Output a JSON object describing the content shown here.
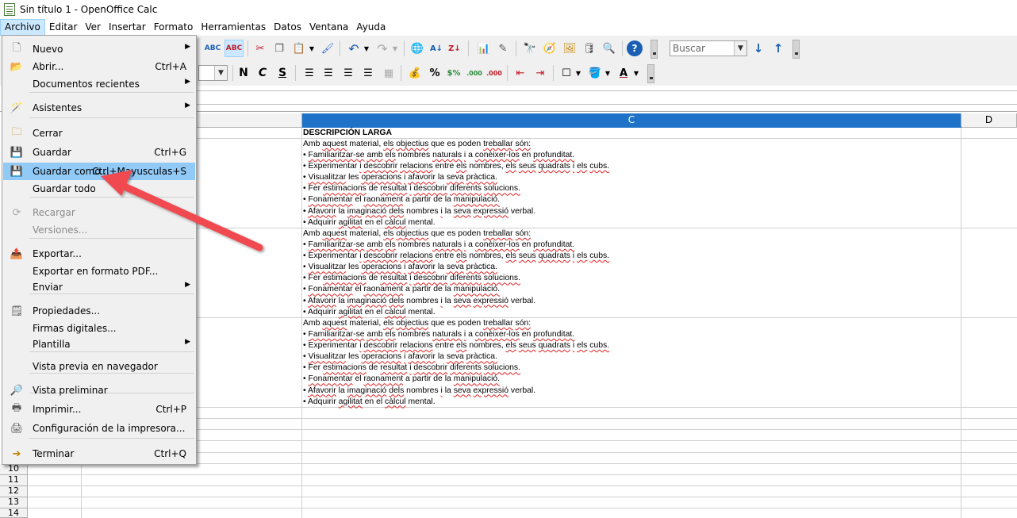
{
  "window": {
    "title": "Sin título 1 - OpenOffice Calc"
  },
  "menubar": [
    "Archivo",
    "Editar",
    "Ver",
    "Insertar",
    "Formato",
    "Herramientas",
    "Datos",
    "Ventana",
    "Ayuda"
  ],
  "toolbar": {
    "search_placeholder": "Buscar",
    "format_bold": "N",
    "format_italic": "C",
    "format_underline": "S"
  },
  "file_menu": {
    "items": [
      {
        "label": "Nuevo",
        "shortcut": "",
        "submenu": true,
        "icon": "new-document-icon"
      },
      {
        "label": "Abrir...",
        "shortcut": "Ctrl+A",
        "submenu": false,
        "icon": "open-folder-icon"
      },
      {
        "label": "Documentos recientes",
        "shortcut": "",
        "submenu": true,
        "icon": ""
      },
      {
        "label": "Asistentes",
        "shortcut": "",
        "submenu": true,
        "icon": "wizard-icon"
      },
      {
        "label": "Cerrar",
        "shortcut": "",
        "submenu": false,
        "icon": "close-document-icon"
      },
      {
        "label": "Guardar",
        "shortcut": "Ctrl+G",
        "submenu": false,
        "icon": "save-icon"
      },
      {
        "label": "Guardar como...",
        "shortcut": "Ctrl+Mayusculas+S",
        "submenu": false,
        "icon": "save-as-icon",
        "highlighted": true
      },
      {
        "label": "Guardar todo",
        "shortcut": "",
        "submenu": false,
        "icon": ""
      },
      {
        "label": "Recargar",
        "shortcut": "",
        "submenu": false,
        "icon": "reload-icon",
        "disabled": true
      },
      {
        "label": "Versiones...",
        "shortcut": "",
        "submenu": false,
        "icon": "",
        "disabled": true
      },
      {
        "label": "Exportar...",
        "shortcut": "",
        "submenu": false,
        "icon": "export-icon"
      },
      {
        "label": "Exportar en formato PDF...",
        "shortcut": "",
        "submenu": false,
        "icon": ""
      },
      {
        "label": "Enviar",
        "shortcut": "",
        "submenu": true,
        "icon": ""
      },
      {
        "label": "Propiedades...",
        "shortcut": "",
        "submenu": false,
        "icon": "properties-icon"
      },
      {
        "label": "Firmas digitales...",
        "shortcut": "",
        "submenu": false,
        "icon": ""
      },
      {
        "label": "Plantilla",
        "shortcut": "",
        "submenu": true,
        "icon": ""
      },
      {
        "label": "Vista previa en navegador",
        "shortcut": "",
        "submenu": false,
        "icon": ""
      },
      {
        "label": "Vista preliminar",
        "shortcut": "",
        "submenu": false,
        "icon": "print-preview-icon"
      },
      {
        "label": "Imprimir...",
        "shortcut": "Ctrl+P",
        "submenu": false,
        "icon": "printer-icon"
      },
      {
        "label": "Configuración de la impresora...",
        "shortcut": "",
        "submenu": false,
        "icon": "printer-settings-icon"
      },
      {
        "label": "Terminar",
        "shortcut": "Ctrl+Q",
        "submenu": false,
        "icon": "exit-icon"
      }
    ]
  },
  "sheet": {
    "columns": [
      "C",
      "D"
    ],
    "header_cell": "DESCRIPCIÓN LARGA",
    "rows": [
      "10",
      "11",
      "12",
      "13",
      "14"
    ],
    "description_lines": [
      "Amb aquest material, els objectius que es poden treballar són:",
      "• Familiaritzar-se amb els nombres naturals i a conèixer-los en profunditat.",
      "• Experimentar i descobrir relacions entre els nombres, els seus quadrats i els cubs.",
      "• Visualitzar les operacions i afavorir la seva pràctica.",
      "• Fer estimacions de resultat i descobrir diferents solucions.",
      "• Fonamentar el raonament a partir de la manipulació.",
      "• Afavorir la imaginació dels nombres i la seva expressió verbal.",
      "• Adquirir agilitat en el càlcul mental."
    ]
  },
  "colors": {
    "menu_highlight": "#91c9f7",
    "selected_column": "#1e73c8",
    "annotation_arrow": "#f0494f",
    "spellcheck": "#e02020"
  }
}
